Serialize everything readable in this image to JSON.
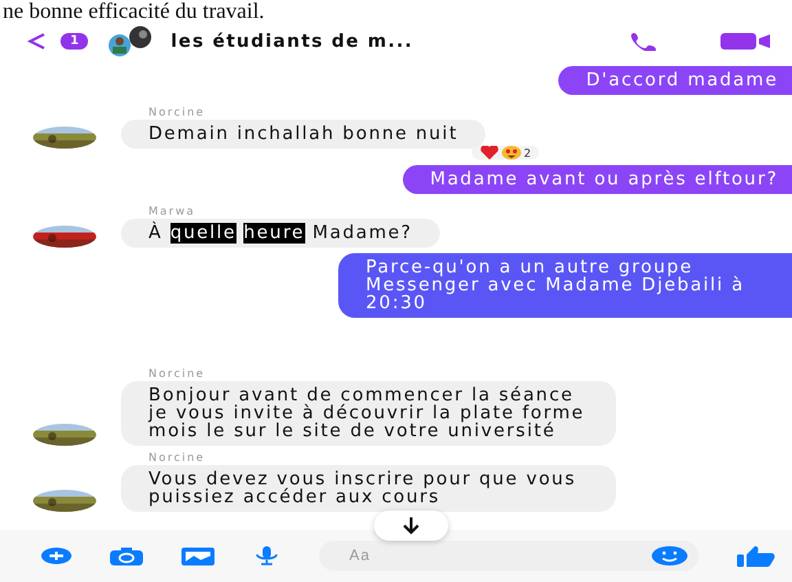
{
  "caption": "ne bonne efficacité du travail.",
  "header": {
    "back_badge": "1",
    "title": "les étudiants de m..."
  },
  "messages": [
    {
      "kind": "outgoing",
      "color": "#8b45f7",
      "parts": [
        {
          "text": "D'accord madame",
          "highlighted": false
        }
      ]
    },
    {
      "kind": "incoming",
      "sender": "Norcine",
      "color": "#8b8a3a",
      "parts": [
        {
          "text": "Demain inchallah bonne nuit",
          "highlighted": false
        }
      ],
      "reaction_count": "2"
    },
    {
      "kind": "outgoing",
      "color": "#8b45f7",
      "parts": [
        {
          "text": "Madame avant ou après elftour?",
          "highlighted": false
        }
      ]
    },
    {
      "kind": "incoming",
      "sender": "Marwa",
      "color": "#c2221c",
      "parts": [
        {
          "text": "À ",
          "highlighted": false
        },
        {
          "text": "quelle",
          "highlighted": true
        },
        {
          "text": "heure",
          "highlighted": true
        },
        {
          "text": " Madame?",
          "highlighted": false
        }
      ]
    },
    {
      "kind": "outgoing",
      "color": "#5a56f5",
      "parts": [
        {
          "text": "Parce-qu'on a un autre groupe Messenger avec Madame Djebaili à 20:30",
          "highlighted": false
        }
      ]
    },
    {
      "kind": "gap"
    },
    {
      "kind": "incoming",
      "sender": "Norcine",
      "color": "#8b8a3a",
      "parts": [
        {
          "text": "Bonjour avant de commencer la séance je vous invite à découvrir la plate forme mois le sur le site de votre université",
          "highlighted": false
        }
      ]
    },
    {
      "kind": "incoming",
      "sender": "Norcine",
      "color": "#8b8a3a",
      "parts": [
        {
          "text": "Vous devez vous inscrire pour que vous puissiez accéder aux cours",
          "highlighted": false
        }
      ]
    }
  ],
  "composer": {
    "placeholder": "Aa"
  }
}
